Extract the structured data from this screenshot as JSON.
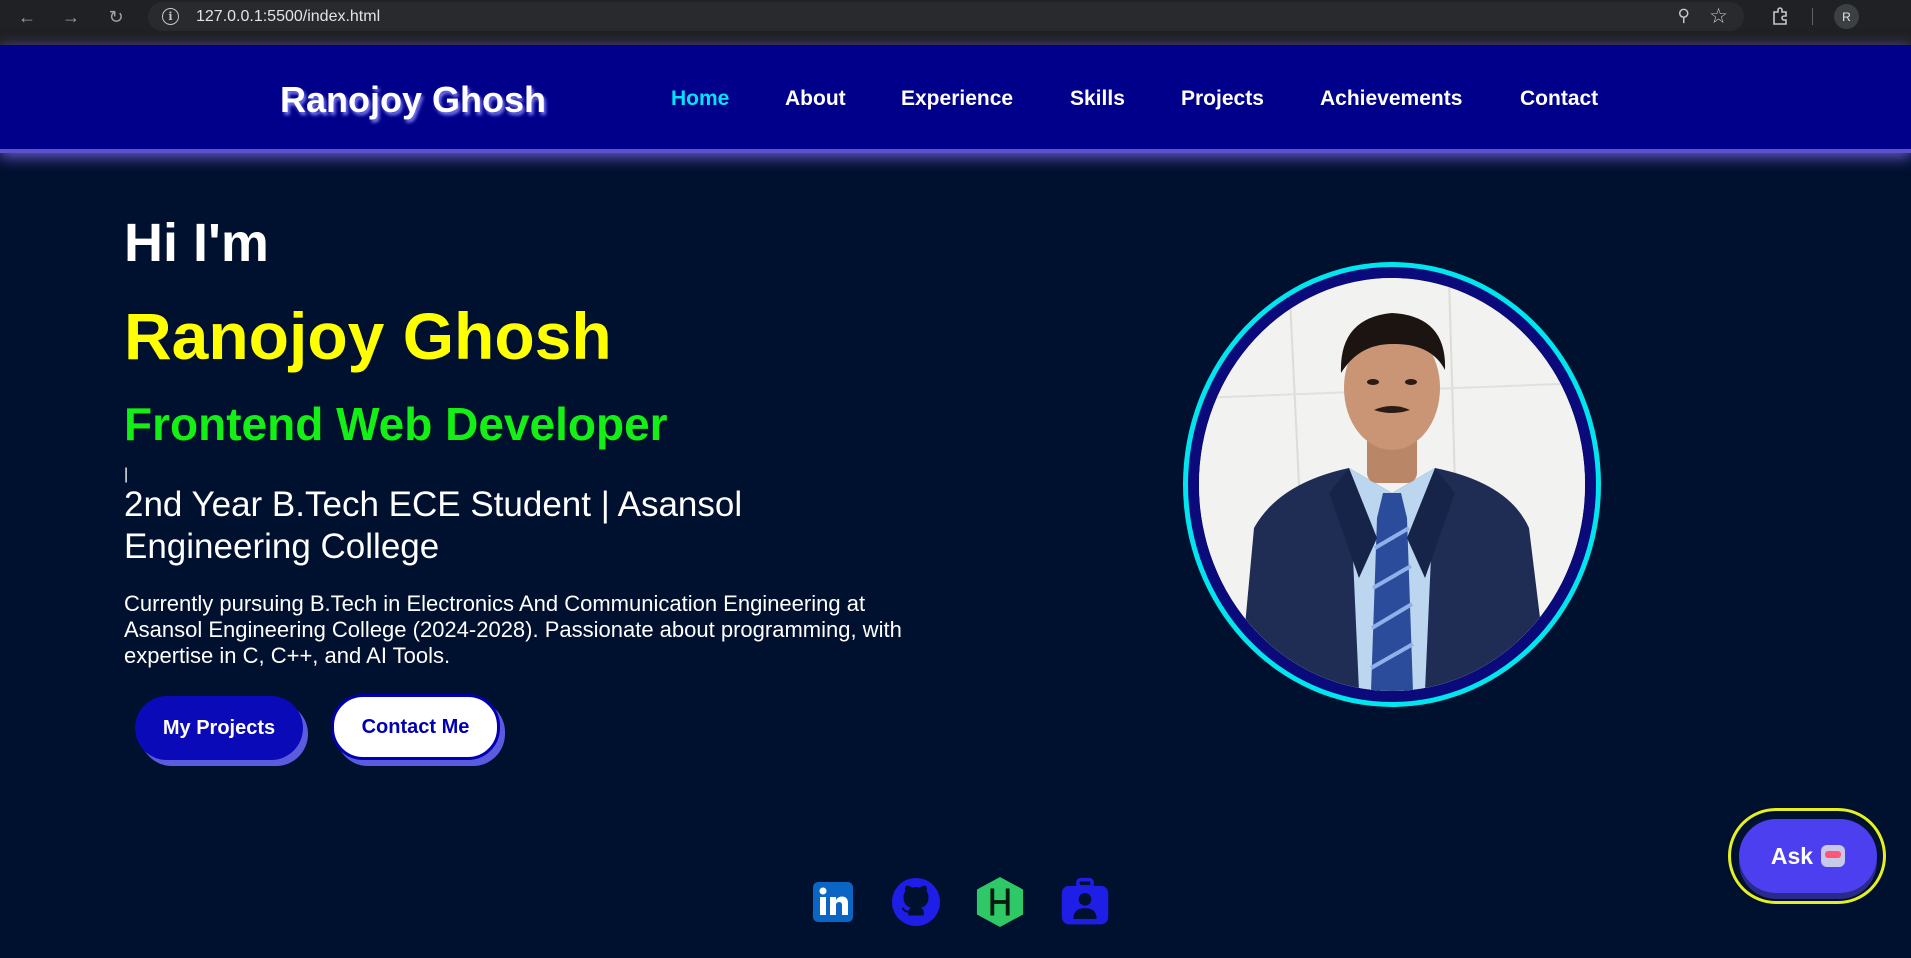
{
  "browser": {
    "url": "127.0.0.1:5500/index.html",
    "profile_initial": "R",
    "icons": {
      "back": "arrow-left-icon",
      "forward": "arrow-right-icon",
      "reload": "reload-icon",
      "info": "info-icon",
      "zoom": "zoom-icon",
      "bookmark": "star-icon",
      "extensions": "puzzle-icon"
    }
  },
  "header": {
    "logo": "Ranojoy Ghosh",
    "nav": [
      {
        "label": "Home",
        "active": true
      },
      {
        "label": "About",
        "active": false
      },
      {
        "label": "Experience",
        "active": false
      },
      {
        "label": "Skills",
        "active": false
      },
      {
        "label": "Projects",
        "active": false
      },
      {
        "label": "Achievements",
        "active": false
      },
      {
        "label": "Contact",
        "active": false
      }
    ]
  },
  "hero": {
    "greeting": "Hi I'm",
    "name": "Ranojoy Ghosh",
    "role": "Frontend Web Developer",
    "cursor": "|",
    "subtitle": "2nd Year B.Tech ECE Student | Asansol Engineering College",
    "description": "Currently pursuing B.Tech in Electronics And Communication Engineering at Asansol Engineering College (2024-2028). Passionate about programming, with expertise in C, C++, and AI Tools.",
    "buttons": {
      "primary": "My Projects",
      "secondary": "Contact Me"
    }
  },
  "social": [
    {
      "name": "linkedin-icon",
      "color": "#0a66c2"
    },
    {
      "name": "github-icon",
      "color": "#1e1ee6"
    },
    {
      "name": "hackerrank-icon",
      "color": "#2ec866"
    },
    {
      "name": "portfolio-icon",
      "color": "#1e1ee6"
    }
  ],
  "ask": {
    "label": "Ask"
  },
  "colors": {
    "header_bg": "#00008b",
    "page_bg": "#00102f",
    "accent_nav": "#00e5ff",
    "name": "#ffff00",
    "role": "#14f014",
    "ring": "#00e5ee",
    "ask_border": "#e6f020",
    "ask_bg": "#4b3ff0"
  }
}
